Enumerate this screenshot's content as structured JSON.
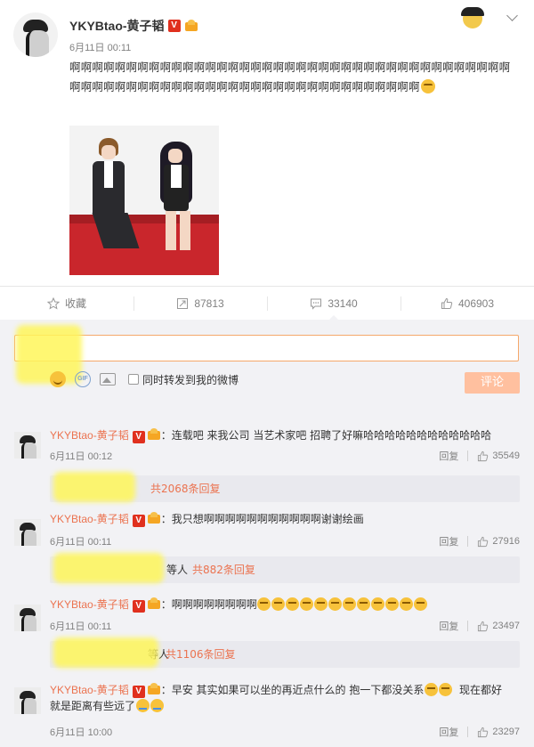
{
  "post": {
    "author": "YKYBtao-黄子韬",
    "verified_badge": "V",
    "time": "6月11日 00:11",
    "text": "啊啊啊啊啊啊啊啊啊啊啊啊啊啊啊啊啊啊啊啊啊啊啊啊啊啊啊啊啊啊啊啊啊啊啊啊啊啊啊啊啊啊啊啊啊啊啊啊啊啊啊啊啊啊啊啊啊啊啊啊啊啊啊啊啊啊啊啊啊啊"
  },
  "actions": {
    "favorite": "收藏",
    "repost_count": "87813",
    "comment_count": "33140",
    "like_count": "406903"
  },
  "composer": {
    "share_label": "同时转发到我的微博",
    "submit_label": "评论"
  },
  "comments": [
    {
      "user": "YKYBtao-黄子韬",
      "text": "：连载吧 来我公司 当艺术家吧 招聘了好嘛哈哈哈哈哈哈哈哈哈哈哈哈",
      "time": "6月11日 00:12",
      "reply_label": "回复",
      "likes": "35549",
      "replies_suffix": "共2068条回复"
    },
    {
      "user": "YKYBtao-黄子韬",
      "text": "：我只想啊啊啊啊啊啊啊啊啊啊啊谢谢绘画",
      "time": "6月11日 00:11",
      "reply_label": "回复",
      "likes": "27916",
      "replies_prefix": "等人",
      "replies_suffix": "共882条回复"
    },
    {
      "user": "YKYBtao-黄子韬",
      "text": "：啊啊啊啊啊啊啊啊",
      "time": "6月11日 00:11",
      "reply_label": "回复",
      "likes": "23497",
      "replies_prefix": "等人",
      "replies_suffix": "共1106条回复"
    },
    {
      "user": "YKYBtao-黄子韬",
      "text": "：早安  其实如果可以坐的再近点什么的 抱一下都没关系",
      "text2": "现在都好",
      "text3": "就是距离有些远了",
      "time": "6月11日 10:00",
      "reply_label": "回复",
      "likes": "23297"
    }
  ]
}
